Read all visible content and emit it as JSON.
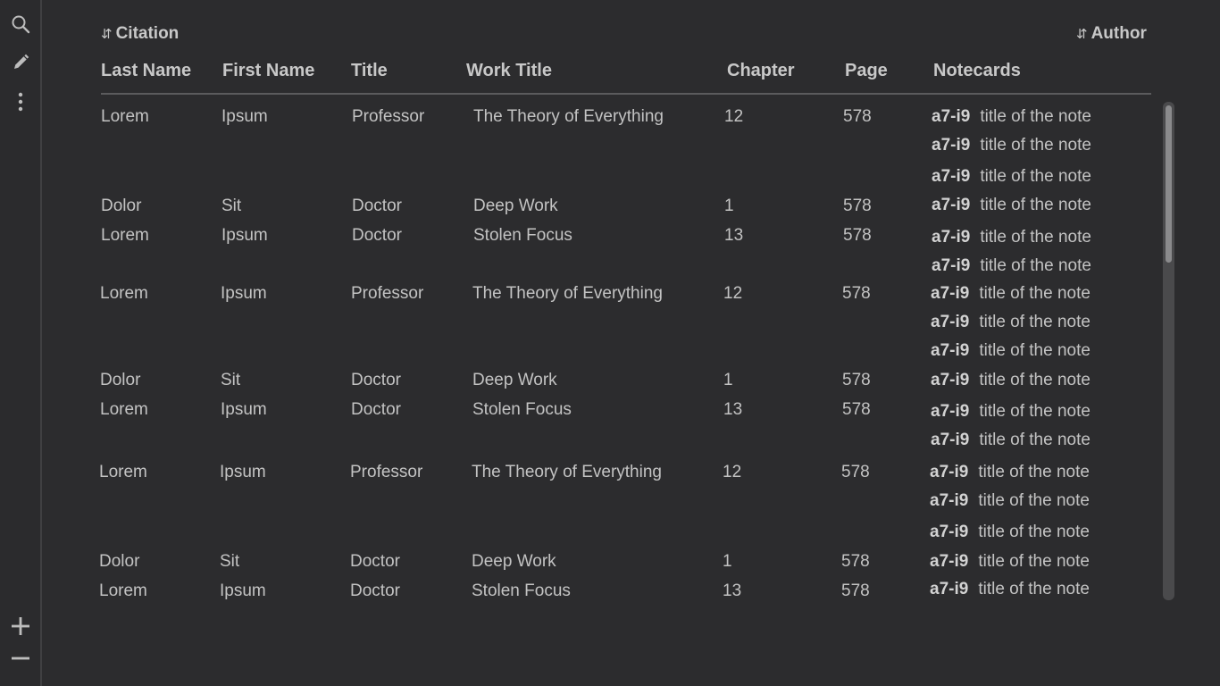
{
  "sidebar": {
    "top_icons": [
      "search-icon",
      "pencil-icon",
      "more-vertical-icon"
    ],
    "bottom_icons": [
      "plus-icon",
      "minus-icon"
    ]
  },
  "sort": {
    "citation_label": "Citation",
    "author_label": "Author",
    "arrows": "⇵"
  },
  "columns": [
    "Last Name",
    "First Name",
    "Title",
    "Work Title",
    "Chapter",
    "Page",
    "Notecards"
  ],
  "rows": [
    {
      "last": "Lorem",
      "first": "Ipsum",
      "title": "Professor",
      "work": "The Theory of Everything",
      "chapter": "12",
      "page": "578",
      "notes": [
        {
          "id": "a7-i9",
          "text": "title of the note"
        },
        {
          "id": "a7-i9",
          "text": "title of the note"
        },
        {
          "id": "a7-i9",
          "text": "title of the note"
        }
      ]
    },
    {
      "last": "Dolor",
      "first": "Sit",
      "title": "Doctor",
      "work": "Deep Work",
      "chapter": "1",
      "page": "578",
      "notes": [
        {
          "id": "a7-i9",
          "text": "title of the note"
        }
      ]
    },
    {
      "last": "Lorem",
      "first": "Ipsum",
      "title": "Doctor",
      "work": "Stolen Focus",
      "chapter": "13",
      "page": "578",
      "notes": [
        {
          "id": "a7-i9",
          "text": "title of the note"
        },
        {
          "id": "a7-i9",
          "text": "title of the note"
        }
      ]
    },
    {
      "last": "Lorem",
      "first": "Ipsum",
      "title": "Professor",
      "work": "The Theory of Everything",
      "chapter": "12",
      "page": "578",
      "notes": [
        {
          "id": "a7-i9",
          "text": "title of the note"
        },
        {
          "id": "a7-i9",
          "text": "title of the note"
        },
        {
          "id": "a7-i9",
          "text": "title of the note"
        }
      ]
    },
    {
      "last": "Dolor",
      "first": "Sit",
      "title": "Doctor",
      "work": "Deep Work",
      "chapter": "1",
      "page": "578",
      "notes": [
        {
          "id": "a7-i9",
          "text": "title of the note"
        }
      ]
    },
    {
      "last": "Lorem",
      "first": "Ipsum",
      "title": "Doctor",
      "work": "Stolen Focus",
      "chapter": "13",
      "page": "578",
      "notes": [
        {
          "id": "a7-i9",
          "text": "title of the note"
        },
        {
          "id": "a7-i9",
          "text": "title of the note"
        }
      ]
    },
    {
      "last": "Lorem",
      "first": "Ipsum",
      "title": "Professor",
      "work": "The Theory of Everything",
      "chapter": "12",
      "page": "578",
      "notes": [
        {
          "id": "a7-i9",
          "text": "title of the note"
        },
        {
          "id": "a7-i9",
          "text": "title of the note"
        },
        {
          "id": "a7-i9",
          "text": "title of the note"
        }
      ]
    },
    {
      "last": "Dolor",
      "first": "Sit",
      "title": "Doctor",
      "work": "Deep Work",
      "chapter": "1",
      "page": "578",
      "notes": [
        {
          "id": "a7-i9",
          "text": "title of the note"
        }
      ]
    },
    {
      "last": "Lorem",
      "first": "Ipsum",
      "title": "Doctor",
      "work": "Stolen Focus",
      "chapter": "13",
      "page": "578",
      "notes": [
        {
          "id": "a7-i9",
          "text": "title of the note"
        }
      ]
    }
  ]
}
